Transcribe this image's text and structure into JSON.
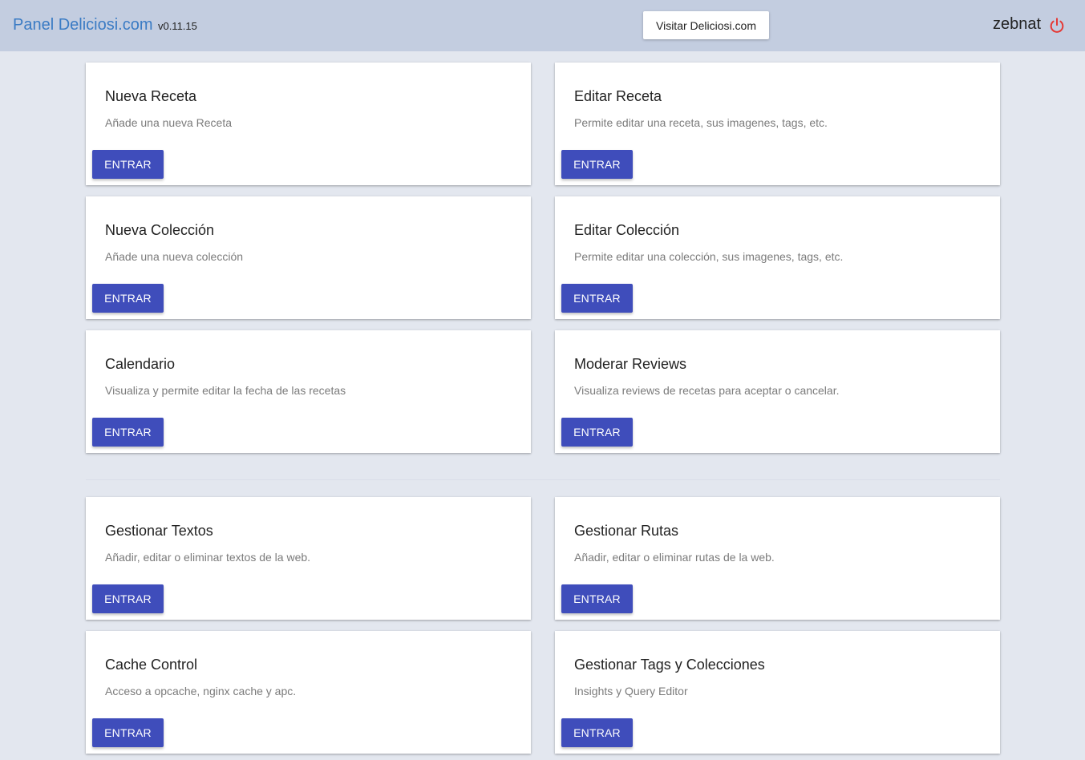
{
  "header": {
    "title": "Panel Deliciosi.com",
    "version": "v0.11.15",
    "visit_button": "Visitar Deliciosi.com",
    "username": "zebnat",
    "logout_icon": "power-icon",
    "logout_color": "#e53935"
  },
  "colors": {
    "header_bg": "#c3cde0",
    "page_bg": "#e3e7ef",
    "brand": "#3a7bc4",
    "button": "#3f4dbb"
  },
  "sections": [
    {
      "cards": [
        {
          "title": "Nueva Receta",
          "description": "Añade una nueva Receta",
          "button": "ENTRAR"
        },
        {
          "title": "Editar Receta",
          "description": "Permite editar una receta, sus imagenes, tags, etc.",
          "button": "ENTRAR"
        },
        {
          "title": "Nueva Colección",
          "description": "Añade una nueva colección",
          "button": "ENTRAR"
        },
        {
          "title": "Editar Colección",
          "description": "Permite editar una colección, sus imagenes, tags, etc.",
          "button": "ENTRAR"
        },
        {
          "title": "Calendario",
          "description": "Visualiza y permite editar la fecha de las recetas",
          "button": "ENTRAR"
        },
        {
          "title": "Moderar Reviews",
          "description": "Visualiza reviews de recetas para aceptar o cancelar.",
          "button": "ENTRAR"
        }
      ]
    },
    {
      "cards": [
        {
          "title": "Gestionar Textos",
          "description": "Añadir, editar o eliminar textos de la web.",
          "button": "ENTRAR"
        },
        {
          "title": "Gestionar Rutas",
          "description": "Añadir, editar o eliminar rutas de la web.",
          "button": "ENTRAR"
        },
        {
          "title": "Cache Control",
          "description": "Acceso a opcache, nginx cache y apc.",
          "button": "ENTRAR"
        },
        {
          "title": "Gestionar Tags y Colecciones",
          "description": "Insights y Query Editor",
          "button": "ENTRAR"
        }
      ]
    }
  ]
}
